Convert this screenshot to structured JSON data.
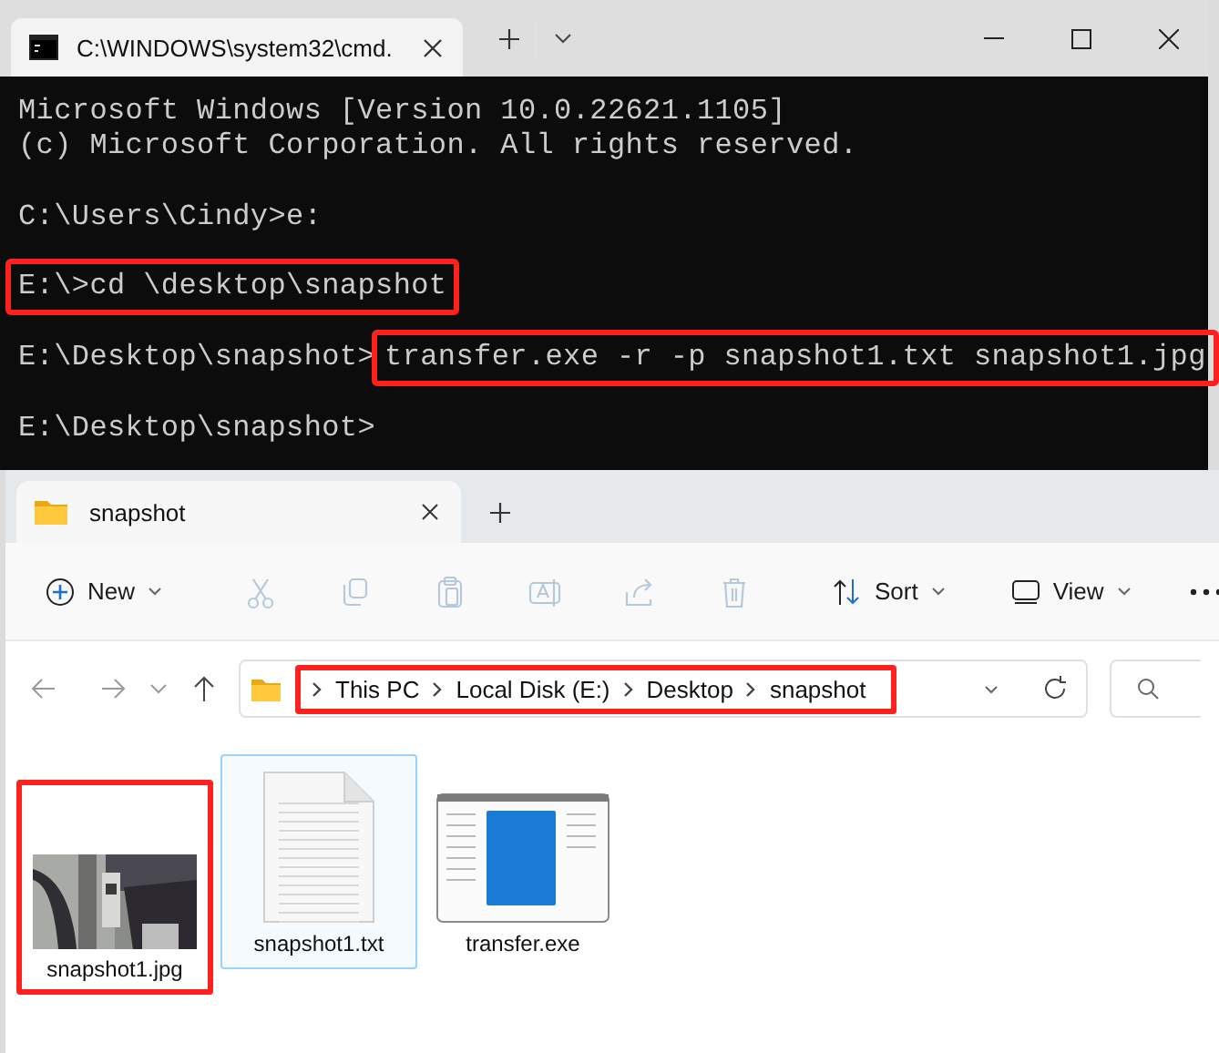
{
  "terminal": {
    "tab_title": "C:\\WINDOWS\\system32\\cmd.",
    "lines": [
      {
        "kind": "output",
        "text": "Microsoft Windows [Version 10.0.22621.1105]"
      },
      {
        "kind": "output",
        "text": "(c) Microsoft Corporation. All rights reserved."
      },
      {
        "kind": "blank"
      },
      {
        "kind": "command",
        "segments": [
          {
            "text": "C:\\Users\\Cindy>e:",
            "highlighted": false
          }
        ]
      },
      {
        "kind": "blank"
      },
      {
        "kind": "command",
        "segments": [
          {
            "text": "E:\\>cd \\desktop\\snapshot",
            "highlighted": true
          }
        ]
      },
      {
        "kind": "blank"
      },
      {
        "kind": "command",
        "segments": [
          {
            "text": "E:\\Desktop\\snapshot>",
            "highlighted": false
          },
          {
            "text": "transfer.exe -r -p snapshot1.txt snapshot1.jpg",
            "highlighted": true
          }
        ]
      },
      {
        "kind": "blank"
      },
      {
        "kind": "command",
        "segments": [
          {
            "text": "E:\\Desktop\\snapshot>",
            "highlighted": false
          }
        ]
      }
    ]
  },
  "explorer": {
    "tab_title": "snapshot",
    "toolbar": {
      "new_label": "New",
      "edit_actions": [
        {
          "disabled": true
        },
        {
          "disabled": true
        },
        {
          "disabled": true
        },
        {
          "disabled": true
        },
        {
          "disabled": true
        },
        {
          "disabled": true
        }
      ],
      "sort_label": "Sort",
      "view_label": "View"
    },
    "breadcrumb": {
      "highlighted": true,
      "parts": [
        "This PC",
        "Local Disk (E:)",
        "Desktop",
        "snapshot"
      ]
    },
    "files": [
      {
        "name": "snapshot1.jpg",
        "selected": false,
        "highlighted": true
      },
      {
        "name": "snapshot1.txt",
        "kind": "text",
        "selected": true,
        "highlighted": false
      },
      {
        "name": "transfer.exe",
        "kind": "app",
        "selected": false,
        "highlighted": false
      }
    ]
  }
}
